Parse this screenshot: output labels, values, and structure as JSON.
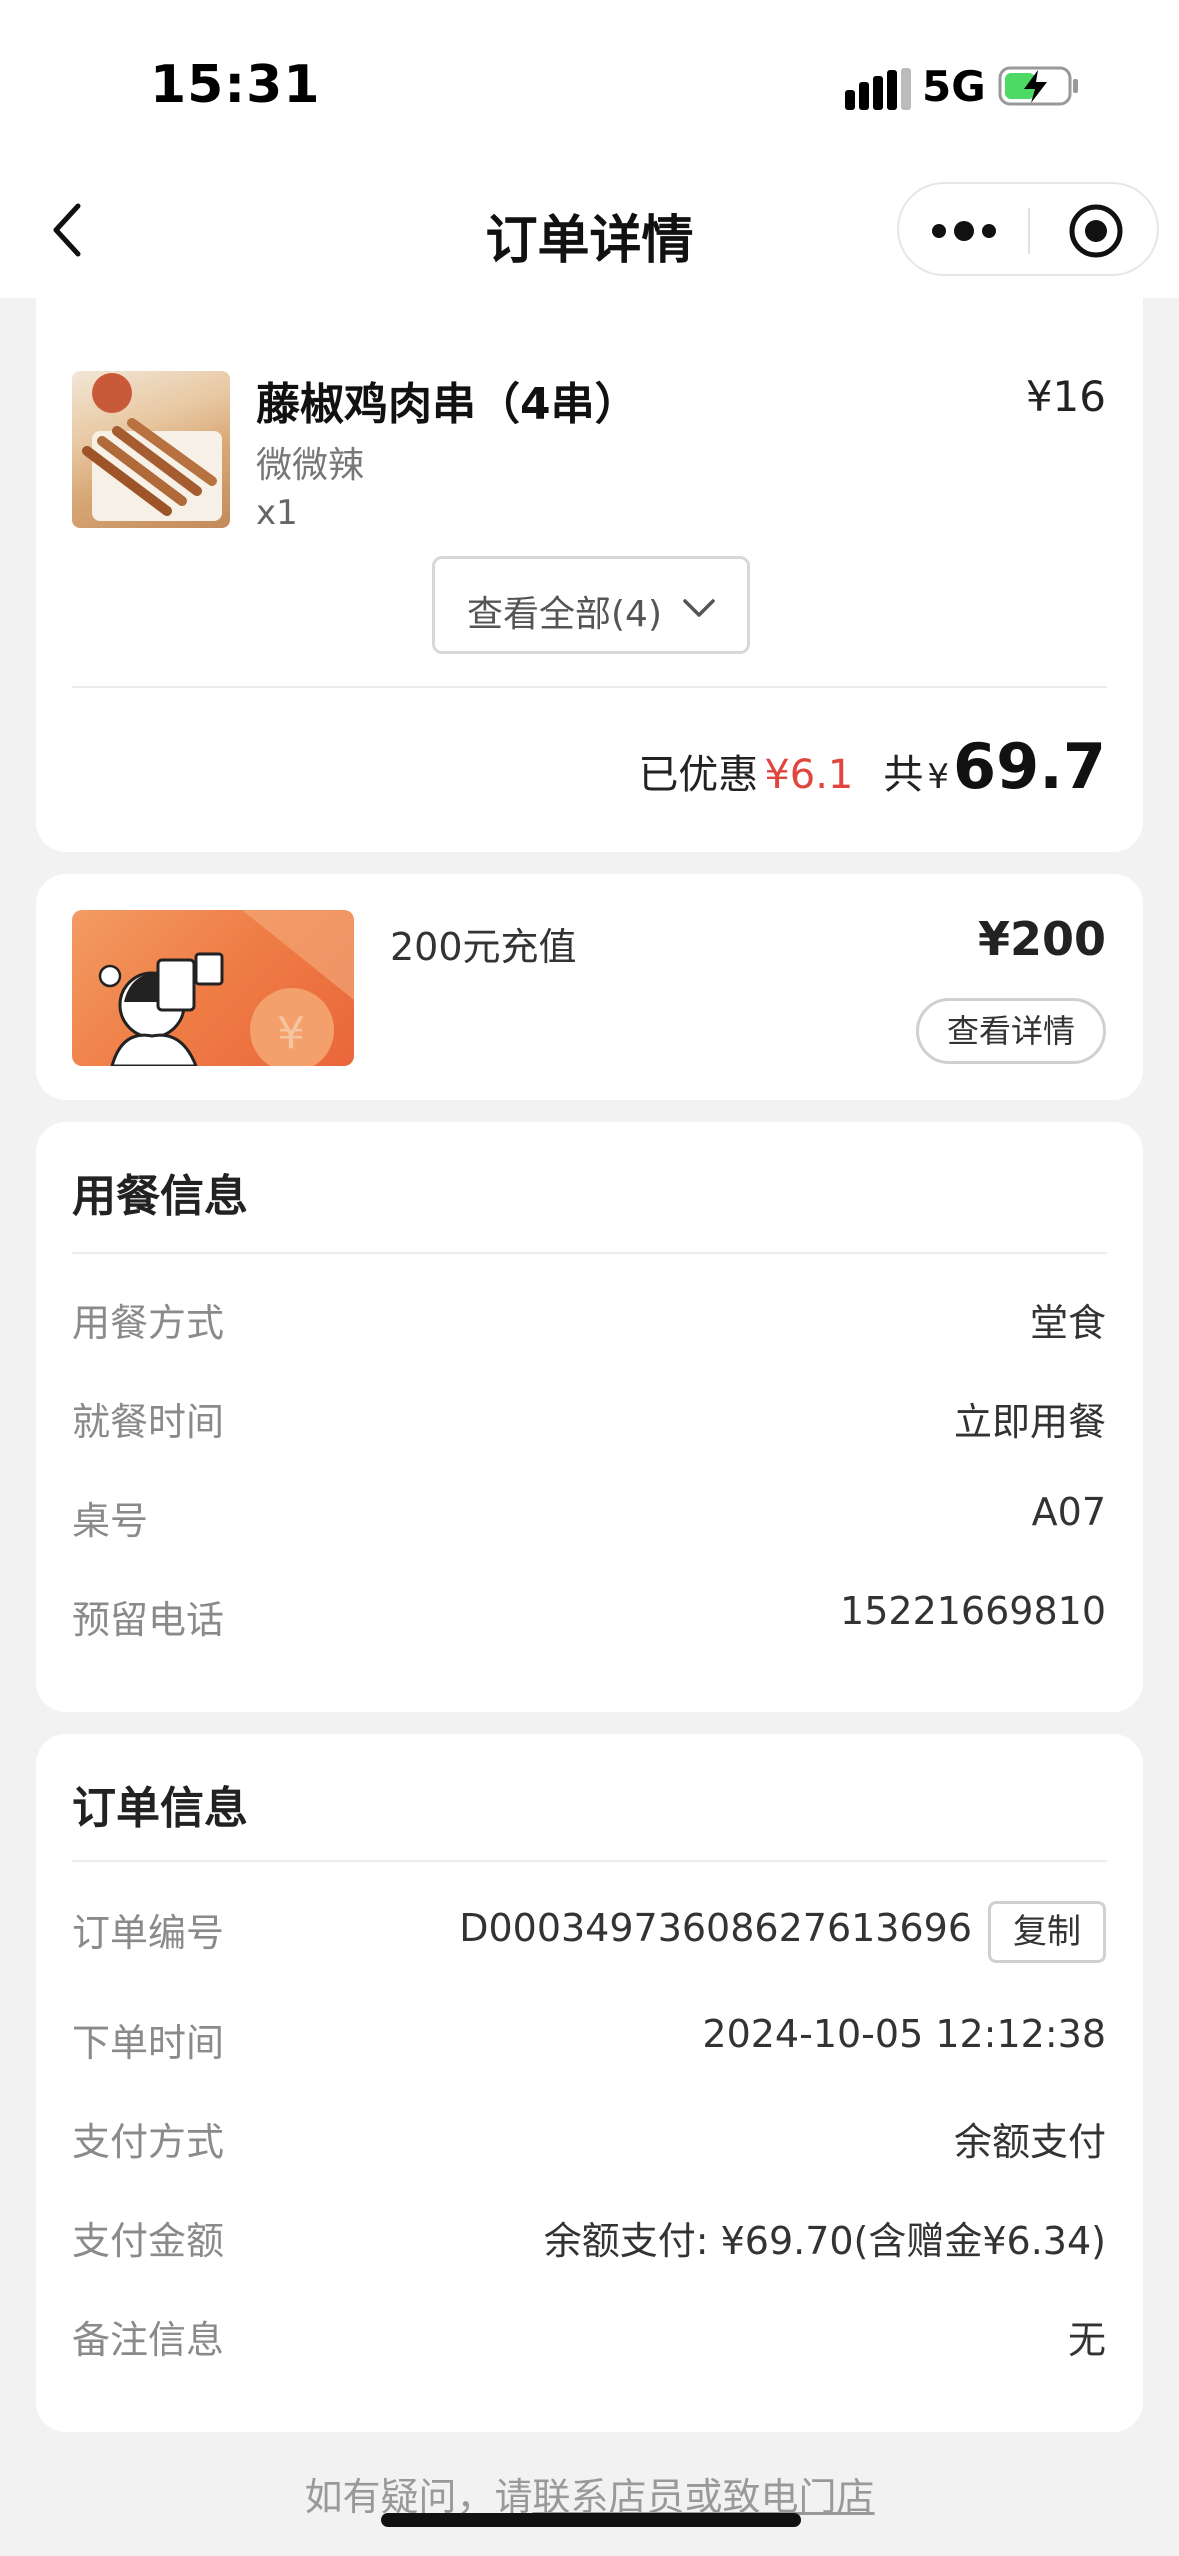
{
  "status": {
    "time": "15:31",
    "network": "5G"
  },
  "nav": {
    "title": "订单详情"
  },
  "items": {
    "cut_item_qty": "x1",
    "item": {
      "name": "藤椒鸡肉串（4串）",
      "price": "¥16",
      "spec": "微微辣",
      "qty": "x1"
    },
    "expand_label": "查看全部(4)"
  },
  "summary": {
    "discount_label": "已优惠",
    "discount_value": "¥6.1",
    "total_label": "共",
    "total_symbol": "¥",
    "total_value": "69.7"
  },
  "recharge": {
    "title": "200元充值",
    "price": "¥200",
    "detail_button": "查看详情"
  },
  "dine_info": {
    "title": "用餐信息",
    "rows": [
      {
        "label": "用餐方式",
        "value": "堂食"
      },
      {
        "label": "就餐时间",
        "value": "立即用餐"
      },
      {
        "label": "桌号",
        "value": "A07"
      },
      {
        "label": "预留电话",
        "value": "15221669810"
      }
    ]
  },
  "order_info": {
    "title": "订单信息",
    "order_no_label": "订单编号",
    "order_no": "D00034973608627613696",
    "copy_button": "复制",
    "rows": [
      {
        "label": "下单时间",
        "value": "2024-10-05 12:12:38"
      },
      {
        "label": "支付方式",
        "value": "余额支付"
      },
      {
        "label": "支付金额",
        "value": "余额支付: ¥69.70(含赠金¥6.34)"
      },
      {
        "label": "备注信息",
        "value": "无"
      }
    ]
  },
  "footer": {
    "prefix": "如有疑问，请",
    "contact_staff": "联系店员",
    "middle": "或",
    "call_store": "致电门店"
  },
  "colors": {
    "accent_red": "#e0463d",
    "page_background": "#f2f2f2",
    "card_background": "#ffffff",
    "recharge_orange": "#ef7c45"
  },
  "icons": [
    "signal-icon",
    "battery-icon",
    "back-icon",
    "more-icon",
    "target-icon",
    "chevron-down-icon"
  ]
}
